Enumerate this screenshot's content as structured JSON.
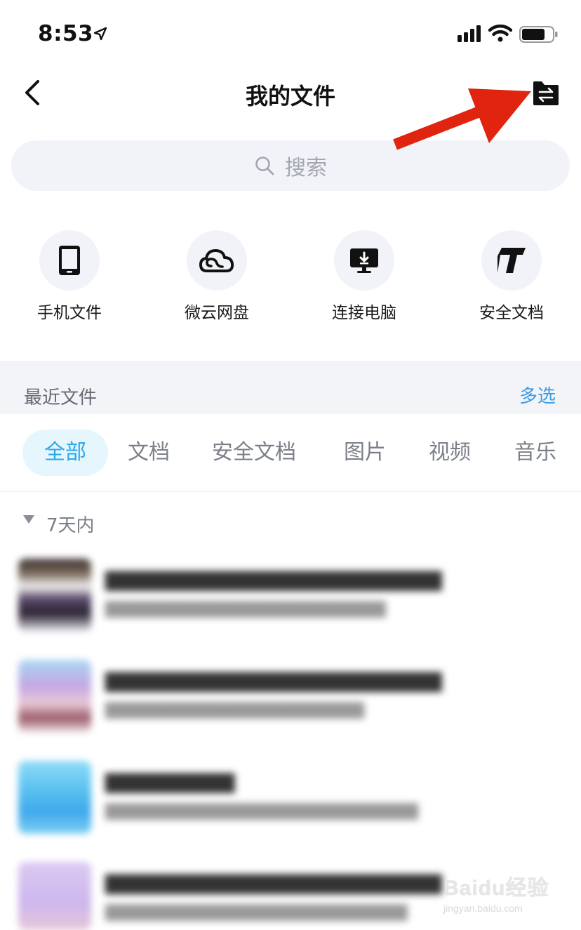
{
  "status_bar": {
    "time": "8:53"
  },
  "nav": {
    "title": "我的文件"
  },
  "search": {
    "placeholder": "搜索"
  },
  "entries": [
    {
      "label": "手机文件",
      "icon": "phone-icon"
    },
    {
      "label": "微云网盘",
      "icon": "cloud-icon"
    },
    {
      "label": "连接电脑",
      "icon": "computer-icon"
    },
    {
      "label": "安全文档",
      "icon": "secure-doc-icon"
    }
  ],
  "recent": {
    "title": "最近文件",
    "multi_select": "多选"
  },
  "tabs": [
    {
      "label": "全部",
      "active": true
    },
    {
      "label": "文档",
      "active": false
    },
    {
      "label": "安全文档",
      "active": false
    },
    {
      "label": "图片",
      "active": false
    },
    {
      "label": "视频",
      "active": false
    },
    {
      "label": "音乐",
      "active": false
    }
  ],
  "group": {
    "title": "7天内"
  },
  "watermark": {
    "brand": "Baidu经验",
    "url": "jingyan.baidu.com"
  },
  "colors": {
    "accent": "#2aa8ec",
    "accent_bg": "#e6f6fd",
    "link": "#3b9ce4",
    "annotation_arrow": "#e0240f",
    "surface": "#f1f3f8"
  }
}
